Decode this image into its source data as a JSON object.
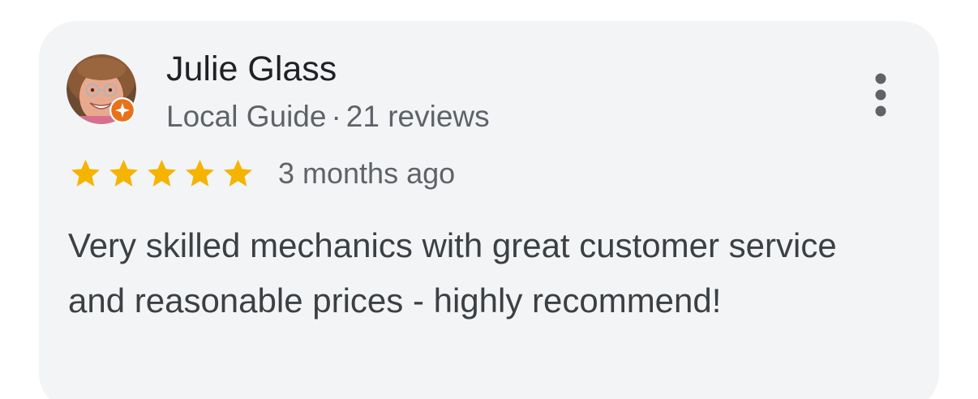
{
  "review": {
    "reviewer_name": "Julie Glass",
    "reviewer_level": "Local Guide",
    "separator": "·",
    "review_count": "21 reviews",
    "rating": 5,
    "rating_max": 5,
    "time_ago": "3 months ago",
    "text": "Very skilled mechanics with great customer service and reasonable prices - highly recommend!"
  },
  "icons": {
    "avatar": "reviewer-avatar-photo",
    "badge": "local-guide-badge-icon",
    "more": "more-vert-icon",
    "star": "star-icon"
  },
  "colors": {
    "card_background": "#f3f4f6",
    "star": "#f4b400",
    "badge": "#e8711a",
    "name": "#202124",
    "secondary_text": "#5f6368",
    "body_text": "#3c4043"
  }
}
